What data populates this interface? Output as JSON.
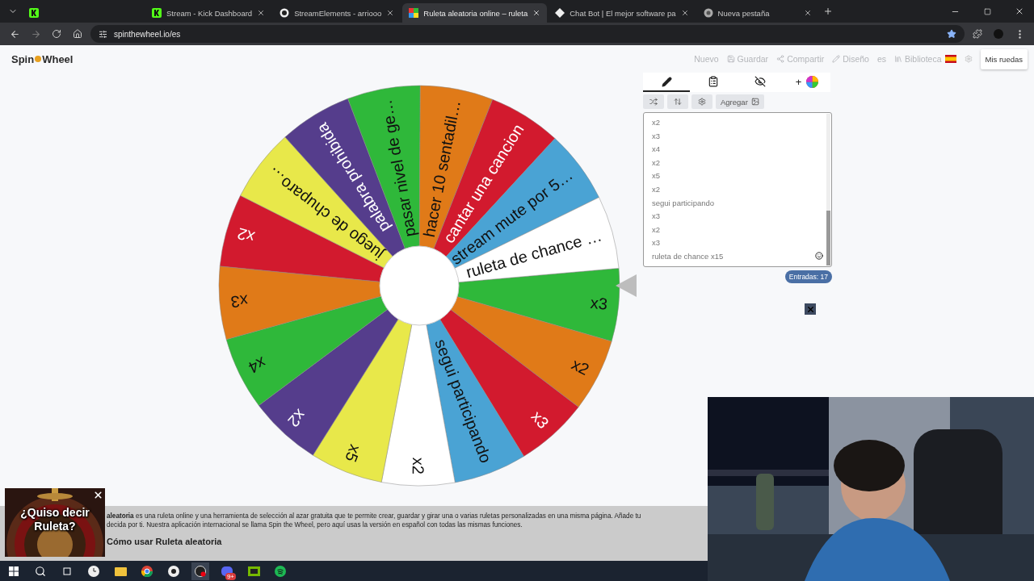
{
  "browser": {
    "tabs": [
      {
        "title": "Stream - Kick Dashboard",
        "selected": false
      },
      {
        "title": "StreamElements - arriooo",
        "selected": false
      },
      {
        "title": "Ruleta aleatoria online – ruleta",
        "selected": true
      },
      {
        "title": "Chat Bot | El mejor software pa",
        "selected": false
      },
      {
        "title": "Nueva pestaña",
        "selected": false
      }
    ],
    "address": "spinthewheel.io/es"
  },
  "site": {
    "logo": [
      "Spin",
      "Wheel"
    ],
    "nav": [
      {
        "label": "Nuevo"
      },
      {
        "label": "Guardar"
      },
      {
        "label": "Compartir"
      },
      {
        "label": "Diseño"
      },
      {
        "label": "es"
      },
      {
        "label": "Biblioteca"
      }
    ],
    "my_wheels": "Mis ruedas"
  },
  "wheel": {
    "segments": [
      {
        "label": "x3",
        "color": "#2fb83a"
      },
      {
        "label": "x2",
        "color": "#e07a18"
      },
      {
        "label": "x3",
        "color": "#d21a2e"
      },
      {
        "label": "segui participando",
        "color": "#4aa3d4"
      },
      {
        "label": "x2",
        "color": "#ffffff"
      },
      {
        "label": "x5",
        "color": "#e8e84a"
      },
      {
        "label": "x2",
        "color": "#553d8c"
      },
      {
        "label": "x4",
        "color": "#2fb83a"
      },
      {
        "label": "x3",
        "color": "#e07a18"
      },
      {
        "label": "x2",
        "color": "#d21a2e"
      },
      {
        "label": "juego de chuparo…",
        "color": "#e8e84a"
      },
      {
        "label": "palabra prohibida",
        "color": "#553d8c"
      },
      {
        "label": "pasar nivel de ge…",
        "color": "#2fb83a"
      },
      {
        "label": "hacer 10 sentadil…",
        "color": "#e07a18"
      },
      {
        "label": "cantar una cancion",
        "color": "#d21a2e"
      },
      {
        "label": "stream mute por 5…",
        "color": "#4aa3d4"
      },
      {
        "label": "ruleta de chance …",
        "color": "#ffffff"
      }
    ]
  },
  "editor": {
    "tabs": [
      {
        "selected": true
      },
      {
        "selected": false
      },
      {
        "selected": false
      },
      {
        "selected": false,
        "label": "+"
      }
    ],
    "add_button": "Agregar",
    "entries": [
      "x2",
      "x3",
      "x4",
      "x2",
      "x5",
      "x2",
      "segui participando",
      "x3",
      "x2",
      "x3",
      "ruleta de chance x15"
    ],
    "count": "Entradas: 17"
  },
  "article": {
    "lines": [
      "**aleatoria** es una ruleta online y una herramienta de selección al azar gratuita que te permite crear, guardar y girar una o varias ruletas personalizadas en una misma página. Añade tu",
      "decida por ti. Nuestra aplicación internacional se llama Spin the Wheel, pero aquí usas la versión en español con todas las mismas funciones."
    ],
    "heading": "Cómo usar Ruleta aleatoria"
  },
  "ad": {
    "text": "¿Quiso decir Ruleta?"
  },
  "taskbar": {
    "badge": "9+"
  }
}
